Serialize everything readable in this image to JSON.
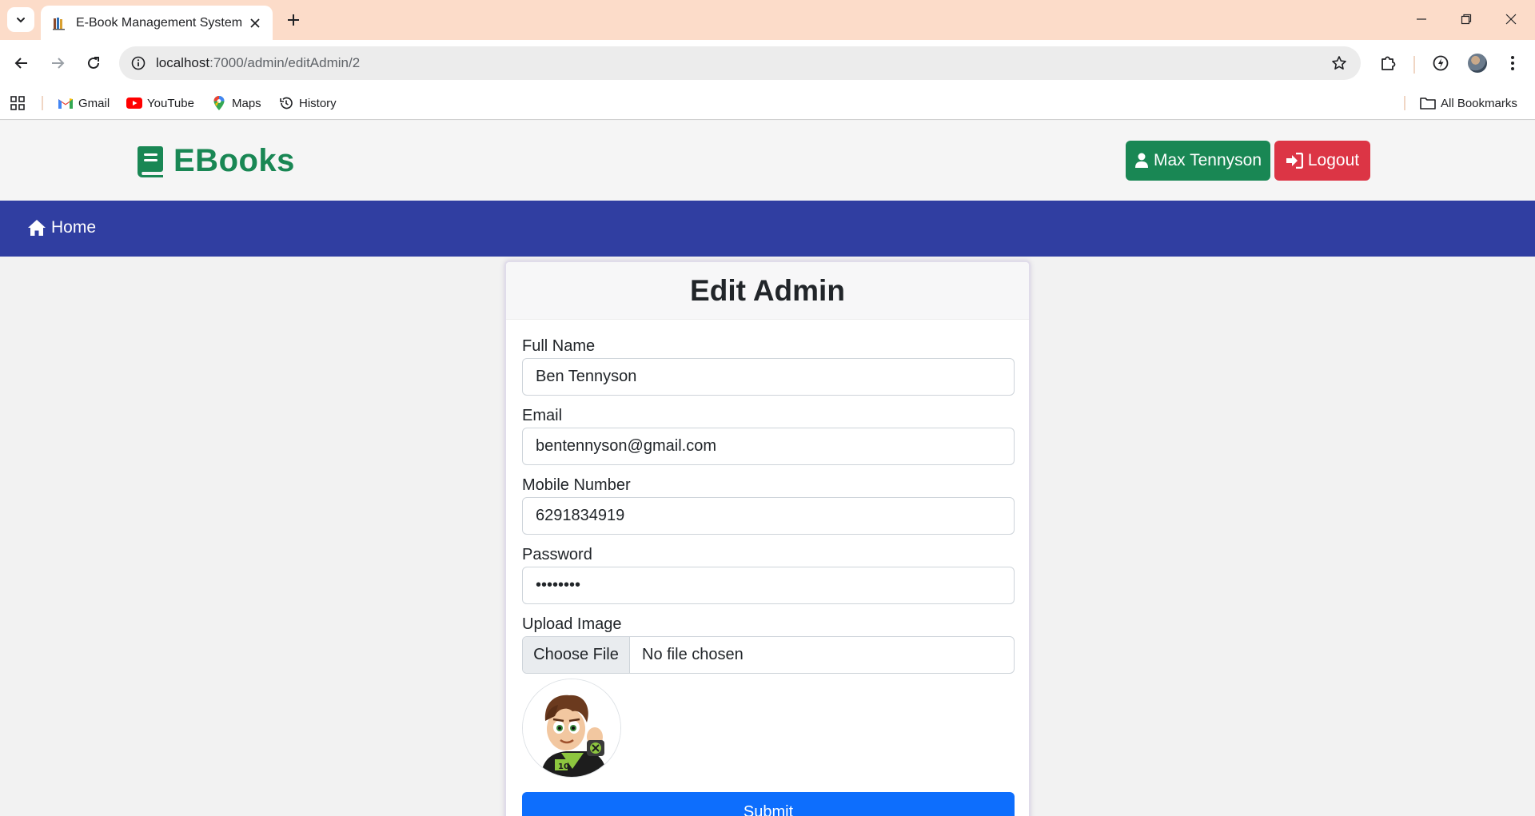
{
  "browser": {
    "tab_title": "E-Book Management System",
    "url_host": "localhost",
    "url_path": ":7000/admin/editAdmin/2",
    "bookmarks": [
      {
        "label": "Gmail",
        "icon": "gmail-icon"
      },
      {
        "label": "YouTube",
        "icon": "youtube-icon"
      },
      {
        "label": "Maps",
        "icon": "maps-icon"
      },
      {
        "label": "History",
        "icon": "history-icon"
      }
    ],
    "all_bookmarks_label": "All Bookmarks"
  },
  "header": {
    "brand": "EBooks",
    "brand_color": "#198754",
    "user_button": "Max Tennyson",
    "logout_button": "Logout",
    "logout_color": "#dc3545"
  },
  "navbar": {
    "home_label": "Home",
    "color": "#303ea1"
  },
  "form": {
    "title": "Edit Admin",
    "full_name_label": "Full Name",
    "full_name_value": "Ben Tennyson",
    "email_label": "Email",
    "email_value": "bentennyson@gmail.com",
    "mobile_label": "Mobile Number",
    "mobile_value": "6291834919",
    "password_label": "Password",
    "password_value": "........",
    "upload_label": "Upload Image",
    "file_button": "Choose File",
    "file_status": "No file chosen",
    "submit_label": "Submit",
    "submit_color": "#0d6efd"
  }
}
